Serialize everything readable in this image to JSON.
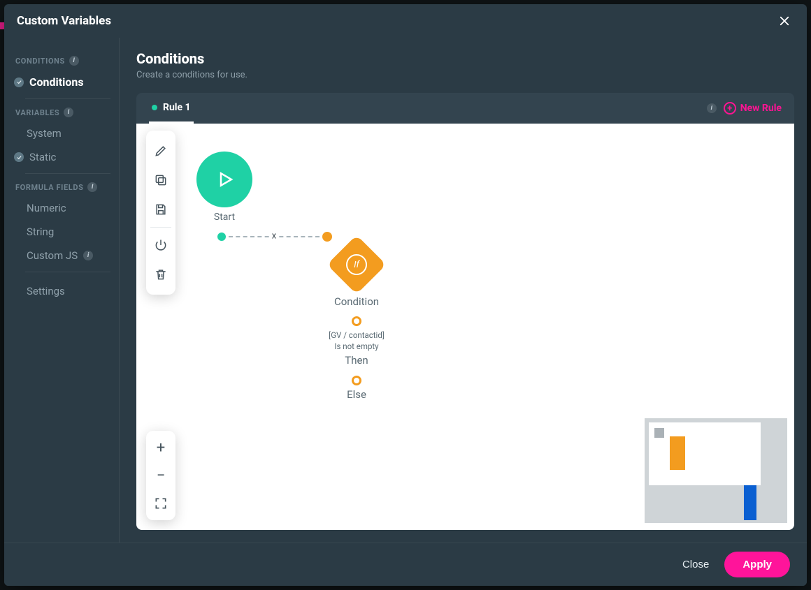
{
  "modal": {
    "title": "Custom Variables"
  },
  "sidebar": {
    "sections": {
      "conditions": {
        "header": "CONDITIONS",
        "items": [
          {
            "label": "Conditions",
            "active": true,
            "checked": true
          }
        ]
      },
      "variables": {
        "header": "VARIABLES",
        "items": [
          {
            "label": "System"
          },
          {
            "label": "Static",
            "checked": true
          }
        ]
      },
      "formula": {
        "header": "FORMULA FIELDS",
        "items": [
          {
            "label": "Numeric"
          },
          {
            "label": "String"
          },
          {
            "label": "Custom JS",
            "info": true
          }
        ]
      }
    },
    "settings": "Settings"
  },
  "main": {
    "title": "Conditions",
    "subtitle": "Create a conditions for use.",
    "tabs": [
      {
        "label": "Rule 1",
        "active": true
      }
    ],
    "new_rule": "New Rule"
  },
  "flow": {
    "start_label": "Start",
    "condition_label": "Condition",
    "condition_diamond": "If",
    "condition_expr_line1": "[GV / contactid]",
    "condition_expr_line2": "Is not empty",
    "then_label": "Then",
    "else_label": "Else",
    "delete_link": "x"
  },
  "footer": {
    "close": "Close",
    "apply": "Apply"
  }
}
